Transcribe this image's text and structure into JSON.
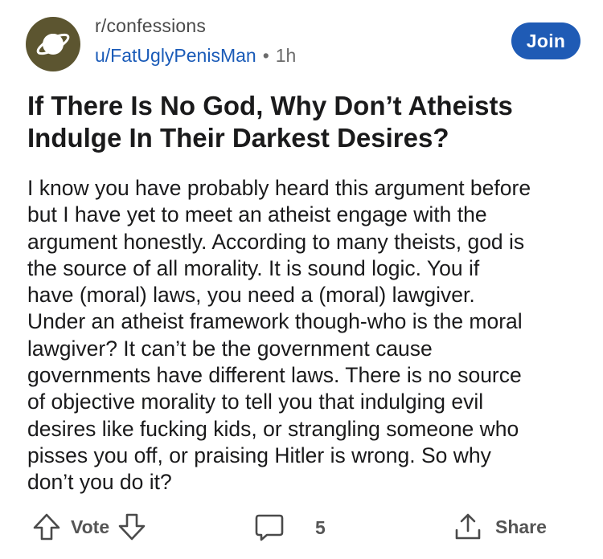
{
  "post": {
    "subreddit": "r/confessions",
    "author": "u/FatUglyPenisMan",
    "separator": "•",
    "age": "1h",
    "join_label": "Join",
    "title": "If There Is No God, Why Don’t Atheists Indulge In Their Darkest Desires?",
    "body": "I know you have probably heard this argument before\nbut I have yet to meet an atheist engage with the\nargument honestly. According to many theists, god is\nthe source of all morality. It is sound logic. You if\nhave (moral) laws, you need a (moral) lawgiver.\nUnder an atheist framework though-who is the moral\nlawgiver? It can’t be the government cause\ngovernments have different laws. There is no source\nof objective morality to tell you that indulging evil\ndesires like fucking kids, or strangling someone who\npisses you off, or praising Hitler is wrong. So why\ndon’t you do it?"
  },
  "actions": {
    "vote_label": "Vote",
    "comment_count": "5",
    "share_label": "Share"
  },
  "icons": {
    "avatar": "planet-icon",
    "upvote": "arrow-up-icon",
    "downvote": "arrow-down-icon",
    "comments": "comment-bubble-icon",
    "share": "share-icon"
  },
  "colors": {
    "join_bg": "#1f5bb5",
    "username": "#1a5bb8",
    "avatar_bg": "#5c5530"
  }
}
